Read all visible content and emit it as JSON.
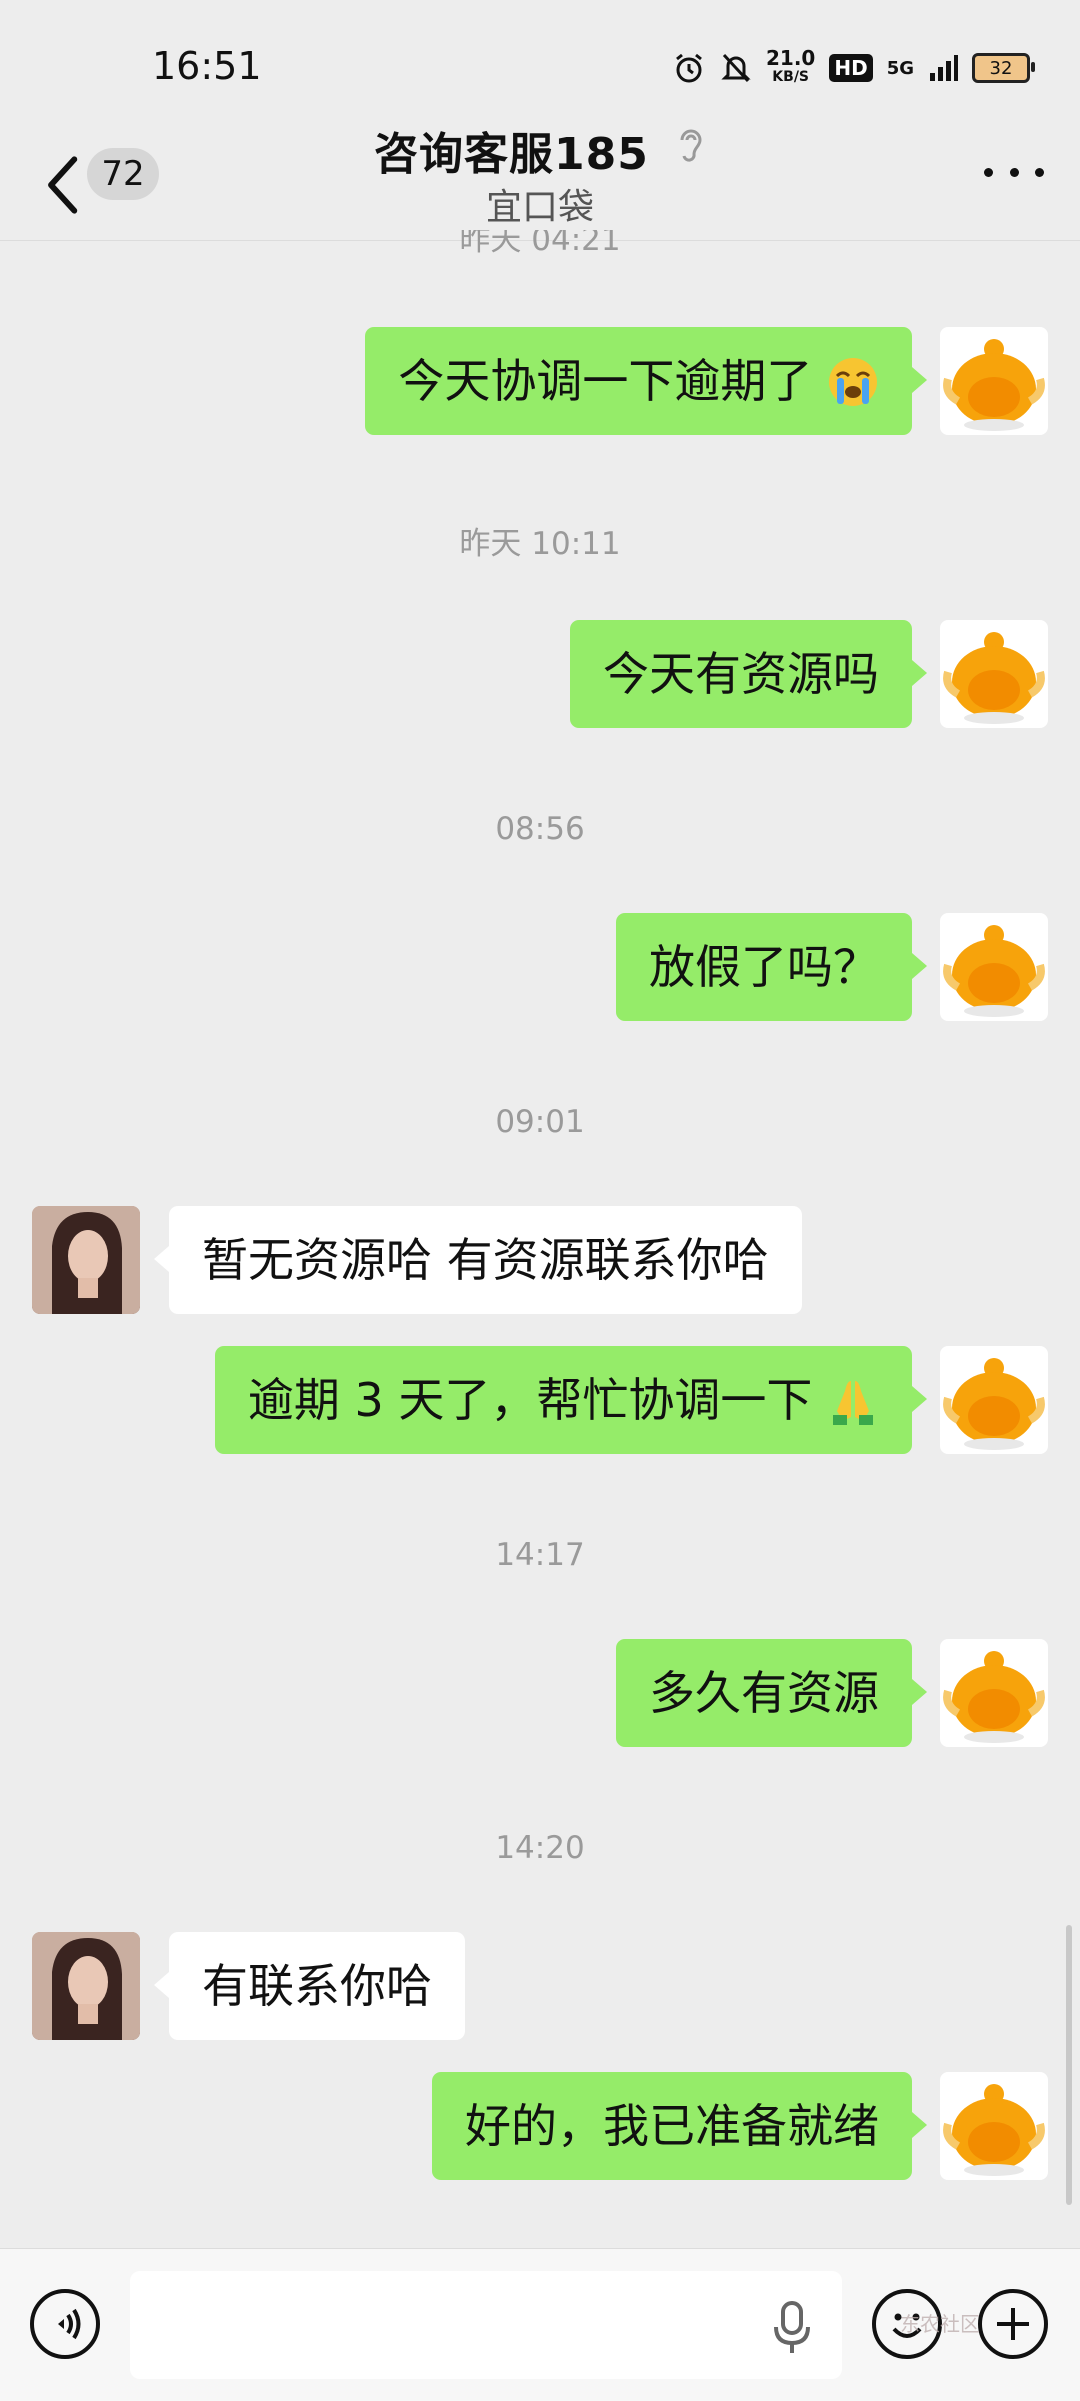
{
  "status_bar": {
    "time": "16:51",
    "speed_value": "21.0",
    "speed_unit": "KB/S",
    "hd_label": "HD",
    "network": "5G",
    "battery": "32"
  },
  "header": {
    "unread_count": "72",
    "title": "咨询客服185",
    "subtitle": "宜口袋"
  },
  "messages": {
    "ts0": "昨天 04:21",
    "m1": "今天协调一下逾期了",
    "ts1": "昨天 10:11",
    "m2": "今天有资源吗",
    "ts2": "08:56",
    "m3": "放假了吗？",
    "ts3": "09:01",
    "m4": "暂无资源哈 有资源联系你哈",
    "m5": "逾期 3 天了，帮忙协调一下",
    "ts4": "14:17",
    "m6": "多久有资源",
    "ts5": "14:20",
    "m7": "有联系你哈",
    "m8": "好的，我已准备就绪"
  },
  "input": {
    "placeholder": ""
  },
  "watermark": "东农社区",
  "colors": {
    "background": "#ededed",
    "outgoing_bubble": "#95ec69",
    "incoming_bubble": "#ffffff",
    "timestamp": "#9a9a9a"
  },
  "icons": {
    "back": "chevron-left-icon",
    "ear": "ear-icon",
    "more": "more-dots-icon",
    "voice": "voice-icon",
    "mic": "microphone-icon",
    "sticker": "smiley-icon",
    "plus": "plus-icon",
    "crying": "crying-face-emoji",
    "pray": "folded-hands-emoji"
  }
}
